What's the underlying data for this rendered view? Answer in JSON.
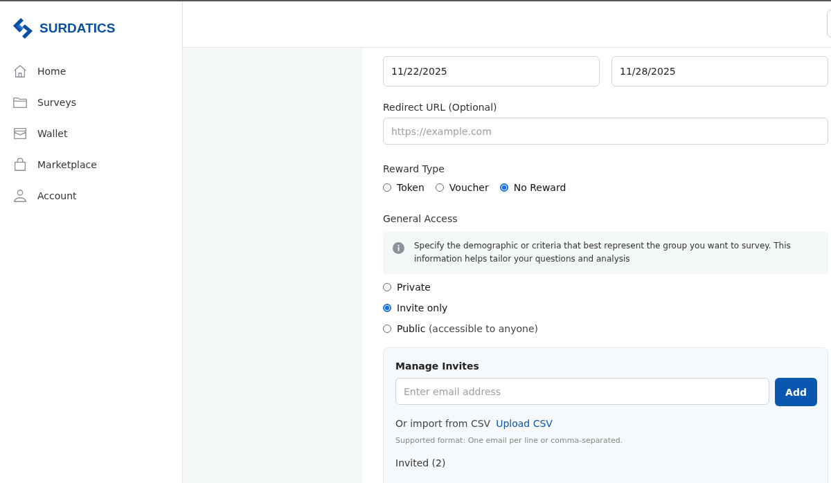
{
  "brand": {
    "name": "SURDATICS"
  },
  "sidebar": {
    "items": [
      {
        "label": "Home",
        "kind": "home"
      },
      {
        "label": "Surveys",
        "kind": "folder"
      },
      {
        "label": "Wallet",
        "kind": "wallet"
      },
      {
        "label": "Marketplace",
        "kind": "bag"
      },
      {
        "label": "Account",
        "kind": "user"
      }
    ]
  },
  "form": {
    "dates": [
      {
        "value": "11/22/2025"
      },
      {
        "value": "11/28/2025"
      }
    ],
    "redirect": {
      "label": "Redirect URL (Optional)",
      "placeholder": "https://example.com"
    },
    "reward_type": {
      "label": "Reward Type",
      "options": [
        {
          "label": "Token",
          "selected": false
        },
        {
          "label": "Voucher",
          "selected": false
        },
        {
          "label": "No Reward",
          "selected": true
        }
      ]
    },
    "general_access": {
      "label": "General Access",
      "info": "Specify the demographic or criteria that best represent the group you want to survey. This information helps tailor your questions and analysis",
      "options": [
        {
          "label": "Private",
          "selected": false
        },
        {
          "label": "Invite only",
          "selected": true
        },
        {
          "label": "Public",
          "note": "(accessible to anyone)",
          "selected": false
        }
      ]
    },
    "invites": {
      "title": "Manage Invites",
      "placeholder": "Enter email address",
      "add_button": "Add",
      "csv_text": "Or import from CSV",
      "csv_link": "Upload CSV",
      "hint": "Supported format: One email per line or comma-separated.",
      "invited": "Invited (2)"
    }
  }
}
